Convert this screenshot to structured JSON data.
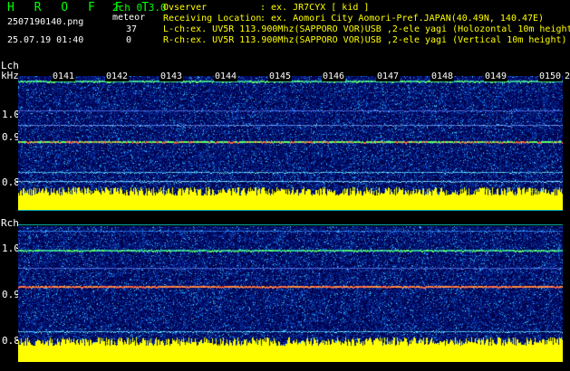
{
  "header": {
    "app_title": "H R O F F T",
    "mode": "2ch 0.3.0",
    "filename": "2507190140.png",
    "event_label": "meteor",
    "lch_count": "37",
    "rch_count": "0",
    "datetime": "25.07.19 01:40",
    "observer_label": "Ovserver",
    "observer_value": ": ex. JR7CYX [ kid ]",
    "location_label": "Receiving Location",
    "location_value": ": ex. Aomori City Aomori-Pref.JAPAN(40.49N, 140.47E)",
    "lch_info": "L-ch:ex. UV5R 113.900Mhz(SAPPORO VOR)USB ,2-ele yagi (Holozontal 10m height",
    "rch_info": "R-ch:ex. UV5R 113.900Mhz(SAPPORO VOR)USB ,2-ele yagi (Vertical 10m height)"
  },
  "top_channel": {
    "label": "Lch",
    "unit": "kHz",
    "yticks": [
      "1.0",
      "0.9",
      "0.8"
    ]
  },
  "bottom_channel": {
    "label": "Rch",
    "yticks": [
      "1.0",
      "0.9",
      "0.8"
    ]
  },
  "seconds": [
    "0141",
    "0142",
    "0143",
    "0144",
    "0145",
    "0146",
    "0147",
    "0148",
    "0149",
    "0150",
    "2"
  ],
  "colors": {
    "header_green": "#00ff00",
    "text_white": "#ffffff",
    "trace_yellow": "#ffff00",
    "waterfall_bg": "#000060",
    "bar_yellow": "#ffff00"
  }
}
